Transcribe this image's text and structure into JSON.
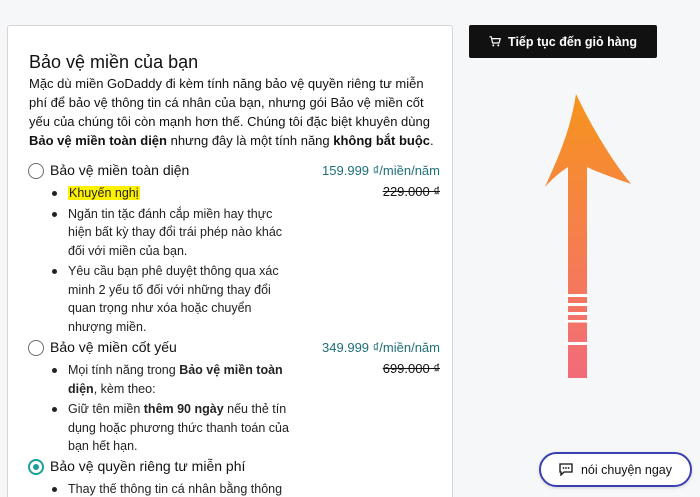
{
  "card": {
    "title": "Bảo vệ miền của bạn",
    "intro_1": "Mặc dù miền GoDaddy đi kèm tính năng bảo vệ quyền riêng tư miễn phí để bảo vệ thông tin cá nhân của bạn, nhưng gói Bảo vệ miền cốt yếu của chúng tôi còn mạnh hơn thế. Chúng tôi đặc biệt khuyên dùng ",
    "intro_bold_1": "Bảo vệ miền toàn diện",
    "intro_2": " nhưng đây là một tính năng ",
    "intro_bold_2": "không bắt buộc",
    "intro_3": "."
  },
  "options": [
    {
      "name": "Bảo vệ miền toàn diện",
      "price": "159.999 ₫/miền/năm",
      "old_price": "229.000 ₫",
      "selected": false,
      "badge": "Khuyến nghị",
      "bullets": [
        "Ngăn tin tặc đánh cắp miền hay thực hiện bất kỳ thay đổi trái phép nào khác đối với miền của bạn.",
        "Yêu cầu bạn phê duyệt thông qua xác minh 2 yếu tố đối với những thay đổi quan trọng như xóa hoặc chuyển nhượng miền."
      ]
    },
    {
      "name": "Bảo vệ miền cốt yếu",
      "price": "349.999 ₫/miền/năm",
      "old_price": "699.000 ₫",
      "selected": false,
      "b1_pre": "Mọi tính năng trong ",
      "b1_bold": "Bảo vệ miền toàn diện",
      "b1_post": ", kèm theo:",
      "b2_pre": "Giữ tên miền ",
      "b2_bold": "thêm 90 ngày",
      "b2_post": " nếu thẻ tín dụng hoặc phương thức thanh toán của bạn hết hạn."
    },
    {
      "name": "Bảo vệ quyền riêng tư miễn phí",
      "selected": true,
      "bullets": [
        "Thay thế thông tin cá nhân bằng thông"
      ]
    }
  ],
  "cart_button": {
    "label": "Tiếp tục đến giỏ hàng",
    "icon": "cart-icon"
  },
  "chat_button": {
    "label": "nói chuyện ngay",
    "icon": "chat-icon"
  },
  "colors": {
    "accent_teal": "#1aa09a",
    "price_teal": "#1d6f7a",
    "highlight": "#fff200",
    "arrow_top": "#f7941d",
    "arrow_bottom": "#f26b7a",
    "chat_border": "#3a3fb2"
  }
}
